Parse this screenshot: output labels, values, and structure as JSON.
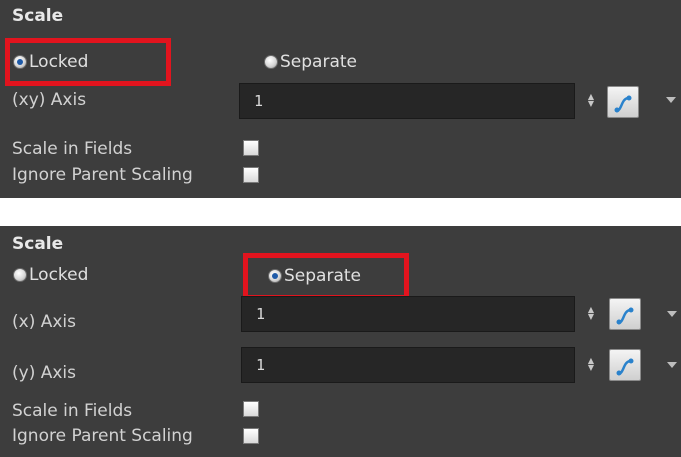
{
  "panel_top": {
    "title": "Scale",
    "radio_locked": "Locked",
    "radio_separate": "Separate",
    "selected": "Locked",
    "axis_label": "(xy) Axis",
    "axis_value": "1",
    "scale_in_fields": "Scale in Fields",
    "ignore_parent_scaling": "Ignore Parent Scaling"
  },
  "panel_bottom": {
    "title": "Scale",
    "radio_locked": "Locked",
    "radio_separate": "Separate",
    "selected": "Separate",
    "x_axis_label": "(x) Axis",
    "x_axis_value": "1",
    "y_axis_label": "(y) Axis",
    "y_axis_value": "1",
    "scale_in_fields": "Scale in Fields",
    "ignore_parent_scaling": "Ignore Parent Scaling"
  },
  "icons": {
    "stepper": "up-down-arrows-icon",
    "function_curve": "function-curve-icon",
    "dropdown": "caret-down-icon"
  },
  "colors": {
    "panel_bg": "#3d3d3d",
    "field_bg": "#262626",
    "highlight": "#e2141e",
    "radio_selected": "#1e5aa8"
  }
}
